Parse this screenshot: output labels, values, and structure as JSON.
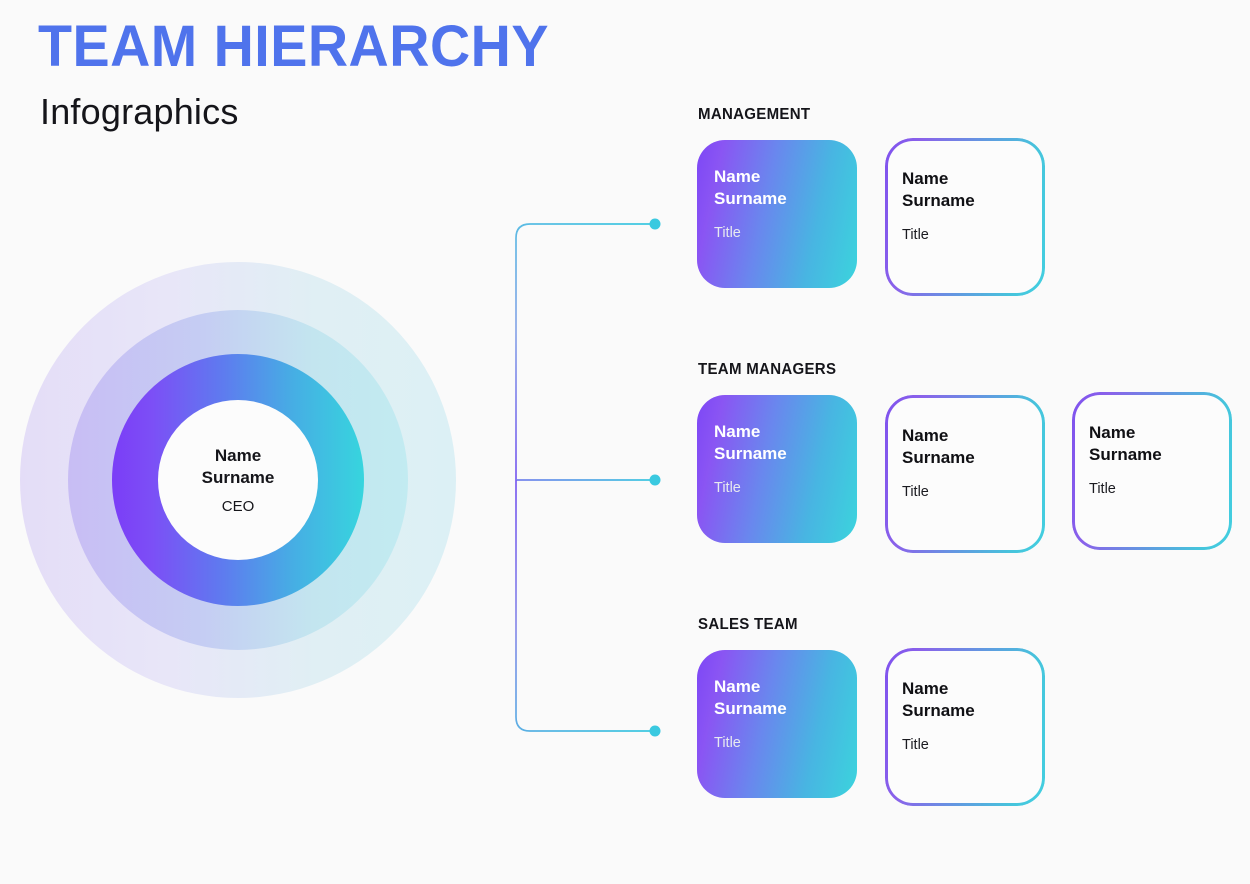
{
  "header": {
    "title": "TEAM HIERARCHY",
    "subtitle": "Infographics",
    "title_color": "#4f73ec"
  },
  "center_node": {
    "name": "Name\nSurname",
    "role": "CEO"
  },
  "palette": {
    "background": "#fafafa",
    "purple": "#7d47f6",
    "cyan": "#3bd4dd",
    "dot": "#3ac9e0",
    "ring_outer_left": "#e4ddf7",
    "ring_outer_right": "#dcf0f5",
    "ring_mid_left": "#c8bdf4",
    "ring_mid_right": "#c2ebf1",
    "ring_inner_left": "#7b3df7",
    "ring_inner_right": "#37d5de",
    "text_dark": "#15151a"
  },
  "groups": [
    {
      "label": "MANAGEMENT",
      "cards": [
        {
          "style": "filled",
          "name": "Name\nSurname",
          "title": "Title"
        },
        {
          "style": "outline",
          "name": "Name\nSurname",
          "title": "Title"
        }
      ]
    },
    {
      "label": "TEAM MANAGERS",
      "cards": [
        {
          "style": "filled",
          "name": "Name\nSurname",
          "title": "Title"
        },
        {
          "style": "outline",
          "name": "Name\nSurname",
          "title": "Title"
        },
        {
          "style": "outline",
          "name": "Name\nSurname",
          "title": "Title"
        }
      ]
    },
    {
      "label": "SALES TEAM",
      "cards": [
        {
          "style": "filled",
          "name": "Name\nSurname",
          "title": "Title"
        },
        {
          "style": "outline",
          "name": "Name\nSurname",
          "title": "Title"
        }
      ]
    }
  ]
}
